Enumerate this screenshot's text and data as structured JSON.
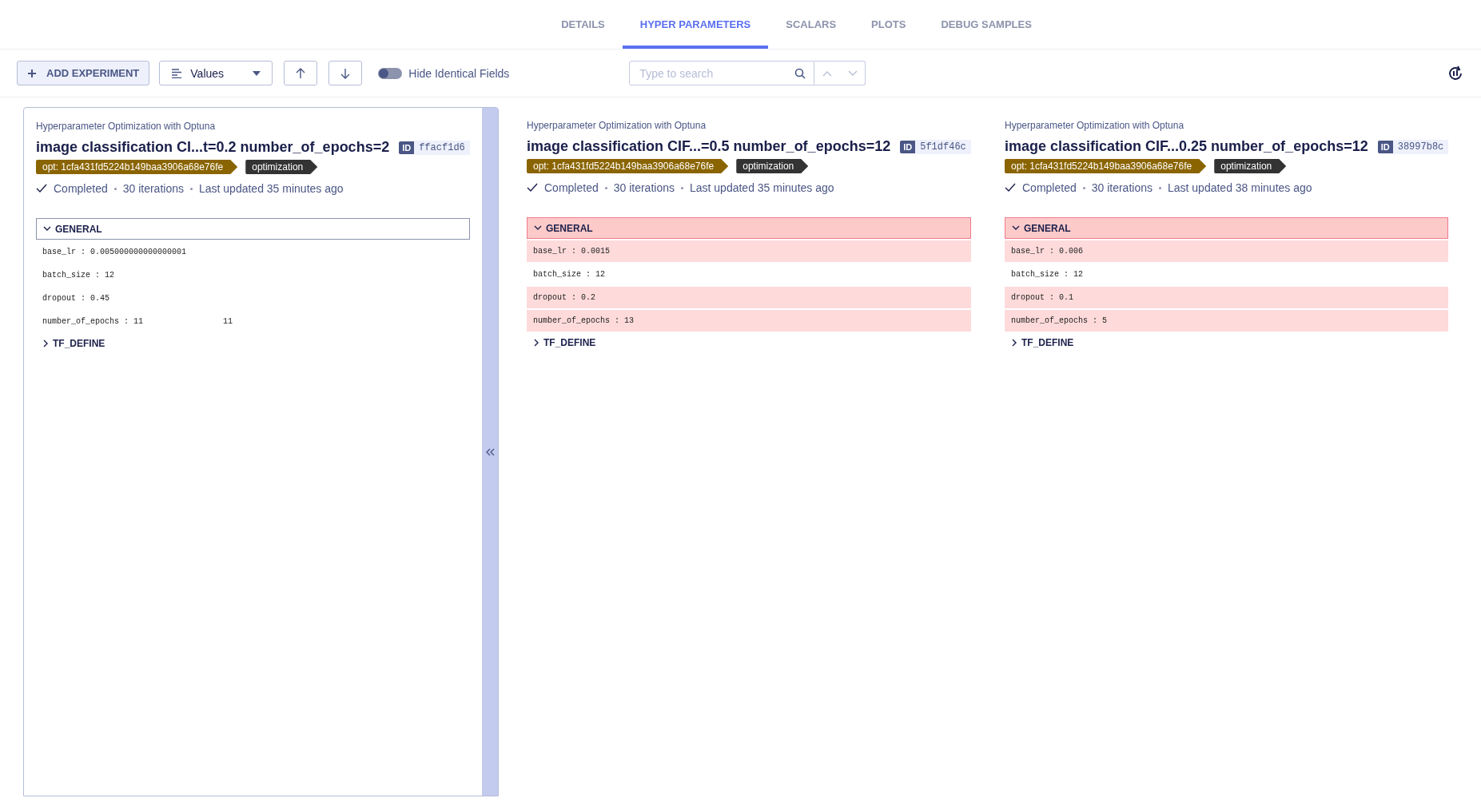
{
  "tabs": [
    {
      "label": "DETAILS",
      "selected": false
    },
    {
      "label": "HYPER PARAMETERS",
      "selected": true
    },
    {
      "label": "SCALARS",
      "selected": false
    },
    {
      "label": "PLOTS",
      "selected": false
    },
    {
      "label": "DEBUG SAMPLES",
      "selected": false
    }
  ],
  "toolbar": {
    "add_button": "ADD EXPERIMENT",
    "view_select": "Values",
    "hide_identical": {
      "label": "Hide Identical Fields",
      "on": false
    },
    "search": {
      "placeholder": "Type to search"
    }
  },
  "experiments": [
    {
      "baseline": true,
      "project": "Hyperparameter Optimization with Optuna",
      "name": "image classification CI...t=0.2 number_of_epochs=2",
      "id_label": "ID",
      "id": "ffacf1d6",
      "tags": [
        {
          "text": "opt: 1cfa431fd5224b149baa3906a68e76fe",
          "color": "#8a6400"
        },
        {
          "text": "optimization",
          "color": "#333333"
        }
      ],
      "status": "Completed",
      "iterations": "30 iterations",
      "updated": "Last updated 35 minutes ago",
      "sections": [
        {
          "title": "GENERAL",
          "expanded": true,
          "differs": false,
          "params": [
            {
              "text": "base_lr : 0.005000000000000001",
              "differs": false
            },
            {
              "text": "batch_size : 12",
              "differs": false
            },
            {
              "text": "dropout : 0.45",
              "differs": false
            },
            {
              "text": "number_of_epochs : 11",
              "differs": false,
              "extra": "11"
            }
          ]
        },
        {
          "title": "TF_DEFINE",
          "expanded": false,
          "differs": false
        }
      ]
    },
    {
      "baseline": false,
      "project": "Hyperparameter Optimization with Optuna",
      "name": "image classification CIF...=0.5 number_of_epochs=12",
      "id_label": "ID",
      "id": "5f1df46c",
      "tags": [
        {
          "text": "opt: 1cfa431fd5224b149baa3906a68e76fe",
          "color": "#8a6400"
        },
        {
          "text": "optimization",
          "color": "#333333"
        }
      ],
      "status": "Completed",
      "iterations": "30 iterations",
      "updated": "Last updated 35 minutes ago",
      "sections": [
        {
          "title": "GENERAL",
          "expanded": true,
          "differs": true,
          "params": [
            {
              "text": "base_lr : 0.0015",
              "differs": true
            },
            {
              "text": "batch_size : 12",
              "differs": false
            },
            {
              "text": "dropout : 0.2",
              "differs": true
            },
            {
              "text": "number_of_epochs : 13",
              "differs": true
            }
          ]
        },
        {
          "title": "TF_DEFINE",
          "expanded": false,
          "differs": false
        }
      ]
    },
    {
      "baseline": false,
      "project": "Hyperparameter Optimization with Optuna",
      "name": "image classification CIF...0.25 number_of_epochs=12",
      "id_label": "ID",
      "id": "38997b8c",
      "tags": [
        {
          "text": "opt: 1cfa431fd5224b149baa3906a68e76fe",
          "color": "#8a6400"
        },
        {
          "text": "optimization",
          "color": "#333333"
        }
      ],
      "status": "Completed",
      "iterations": "30 iterations",
      "updated": "Last updated 38 minutes ago",
      "sections": [
        {
          "title": "GENERAL",
          "expanded": true,
          "differs": true,
          "params": [
            {
              "text": "base_lr : 0.006",
              "differs": true
            },
            {
              "text": "batch_size : 12",
              "differs": false
            },
            {
              "text": "dropout : 0.1",
              "differs": true
            },
            {
              "text": "number_of_epochs : 5",
              "differs": true
            }
          ]
        },
        {
          "title": "TF_DEFINE",
          "expanded": false,
          "differs": false
        }
      ]
    }
  ]
}
